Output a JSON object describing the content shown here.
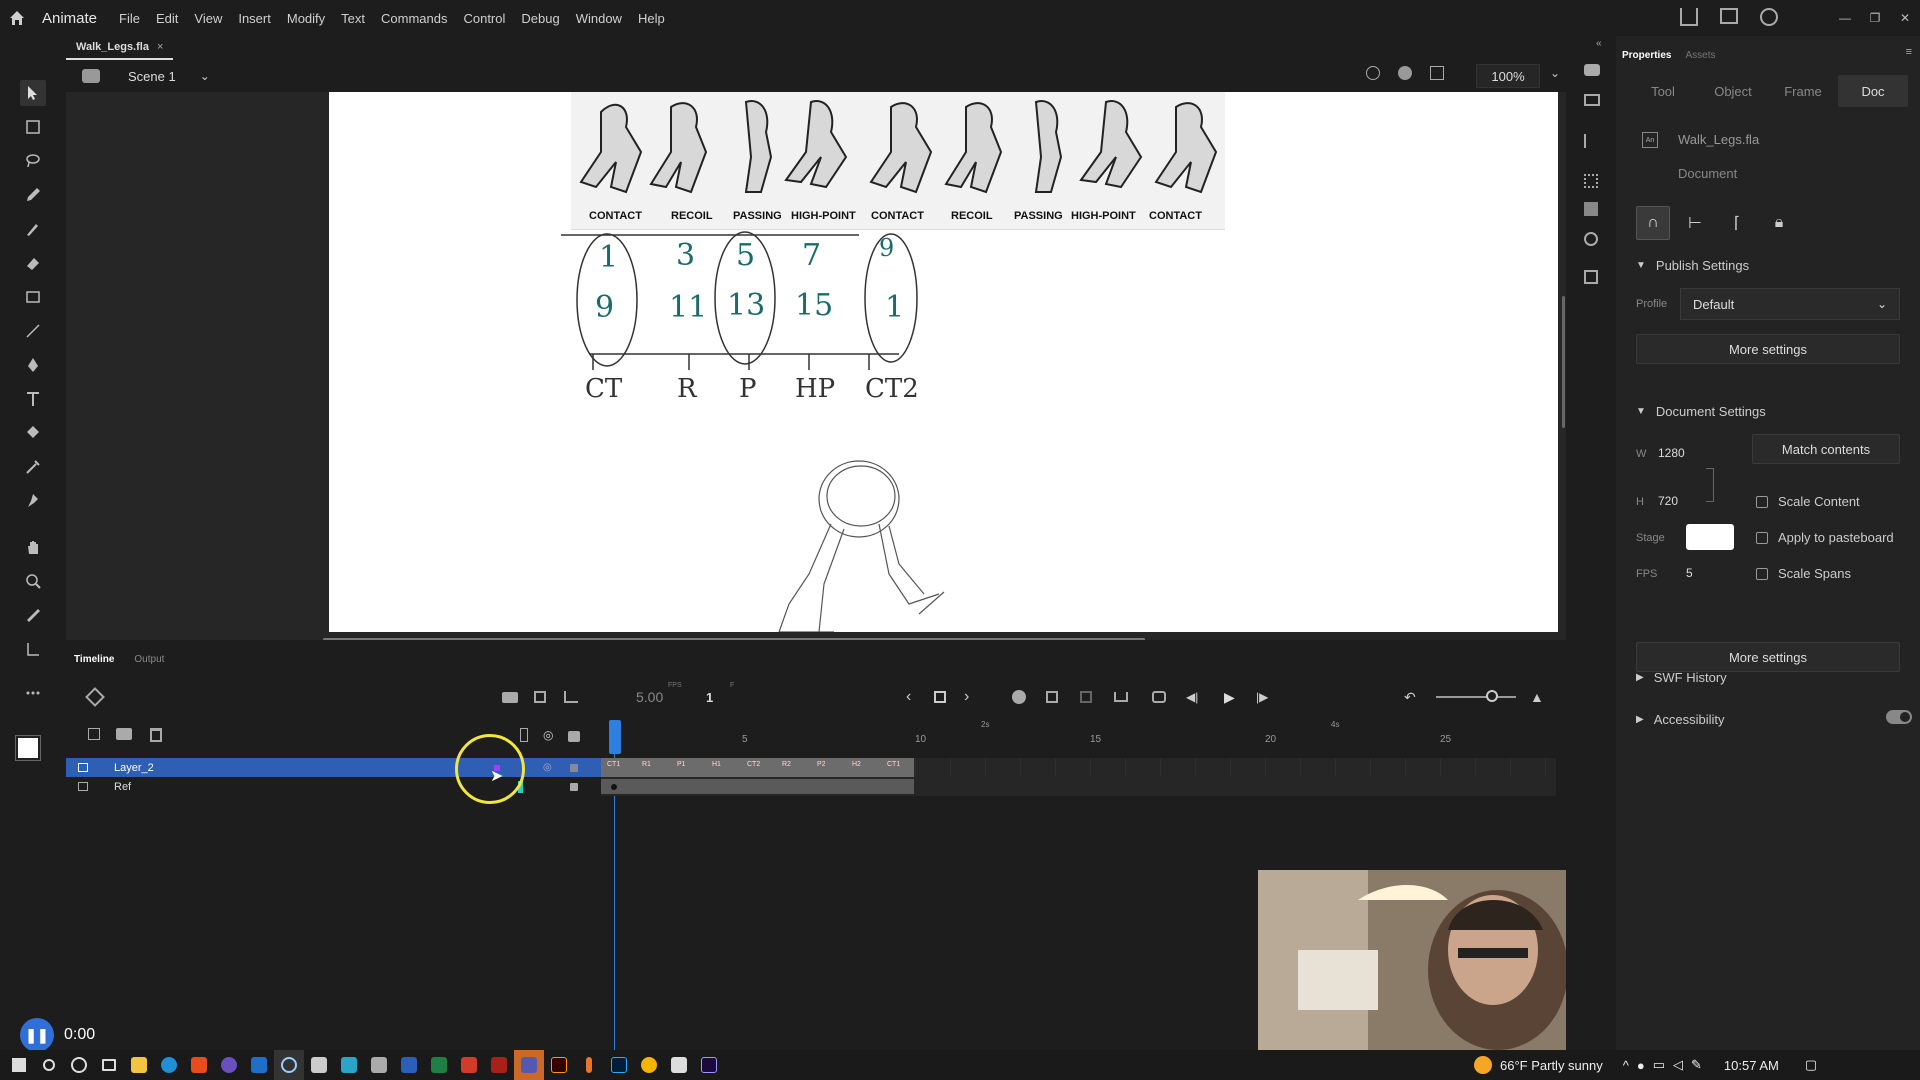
{
  "app": {
    "name": "Animate",
    "menus": [
      "File",
      "Edit",
      "View",
      "Insert",
      "Modify",
      "Text",
      "Commands",
      "Control",
      "Debug",
      "Window",
      "Help"
    ]
  },
  "document_tab": {
    "title": "Walk_Legs.fla",
    "close": "×"
  },
  "scene": {
    "name": "Scene 1",
    "zoom": "100%"
  },
  "stage": {
    "pose_labels": [
      "CONTACT",
      "RECOIL",
      "PASSING",
      "HIGH-POINT",
      "CONTACT",
      "RECOIL",
      "PASSING",
      "HIGH-POINT",
      "CONTACT"
    ],
    "sketch_numbers_top": [
      "1",
      "3",
      "5",
      "7",
      "9"
    ],
    "sketch_numbers_bottom": [
      "9",
      "11",
      "13",
      "15",
      "1"
    ],
    "sketch_labels": [
      "CT",
      "R",
      "P",
      "HP",
      "CT2"
    ]
  },
  "timeline": {
    "tabs": [
      "Timeline",
      "Output"
    ],
    "fps": "5.00",
    "fps_unit": "FPS",
    "frame": "1",
    "frame_unit": "F",
    "ruler_ticks": [
      "5",
      "10",
      "15",
      "20",
      "25"
    ],
    "ruler_seconds": [
      "2s",
      "4s"
    ],
    "layers": [
      {
        "name": "Layer_2",
        "selected": true
      },
      {
        "name": "Ref",
        "selected": false
      }
    ],
    "keyframe_labels": [
      "CT1",
      "R1",
      "P1",
      "H1",
      "CT2",
      "R2",
      "P2",
      "H2",
      "CT1"
    ]
  },
  "properties": {
    "tabs": [
      "Properties",
      "Assets"
    ],
    "subtabs": [
      "Tool",
      "Object",
      "Frame",
      "Doc"
    ],
    "active_subtab": "Doc",
    "file_name": "Walk_Legs.fla",
    "file_type": "Document",
    "publish_settings": {
      "title": "Publish Settings",
      "profile_label": "Profile",
      "profile_value": "Default",
      "more_settings": "More settings"
    },
    "document_settings": {
      "title": "Document Settings",
      "w_label": "W",
      "w_value": "1280",
      "h_label": "H",
      "h_value": "720",
      "match_contents": "Match contents",
      "scale_content": "Scale Content",
      "stage_label": "Stage",
      "apply_pasteboard": "Apply to pasteboard",
      "fps_label": "FPS",
      "fps_value": "5",
      "scale_spans": "Scale Spans",
      "more_settings": "More settings"
    },
    "swf_history": "SWF History",
    "accessibility": "Accessibility"
  },
  "recording": {
    "time": "0:00"
  },
  "taskbar": {
    "weather": "66°F  Partly sunny",
    "time": "10:57 AM"
  },
  "colors": {
    "accent": "#2f5fb4",
    "panel_bg": "#232323",
    "app_bg": "#1d1d1d",
    "ring": "#f1e640"
  }
}
